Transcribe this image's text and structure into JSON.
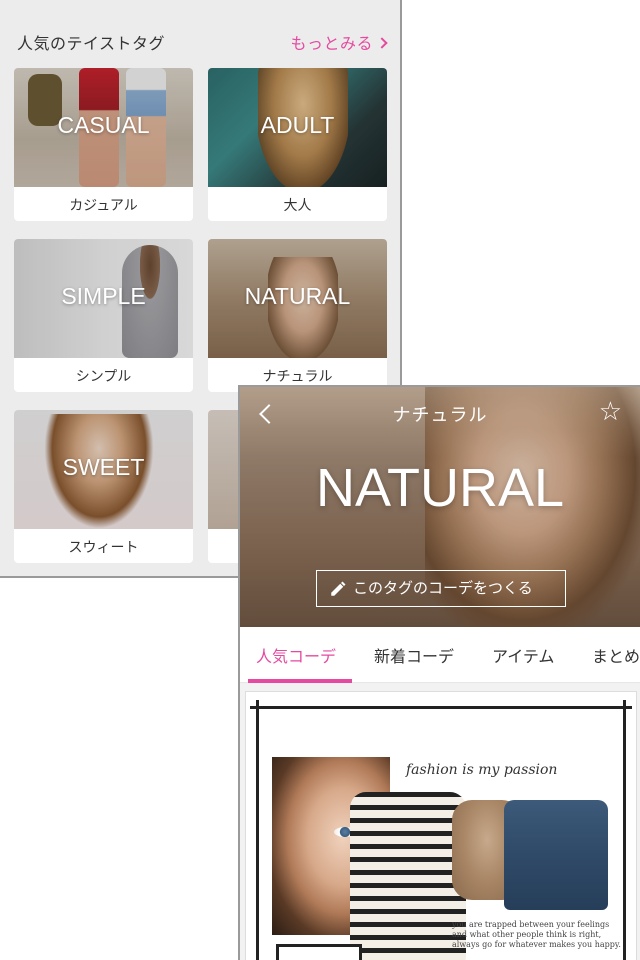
{
  "tags_screen": {
    "title": "人気のテイストタグ",
    "more_label": "もっとみる",
    "more_icon": "chevron-right-icon",
    "accent_color": "#e54aa0",
    "cards": [
      {
        "eng": "CASUAL",
        "jp": "カジュアル"
      },
      {
        "eng": "ADULT",
        "jp": "大人"
      },
      {
        "eng": "SIMPLE",
        "jp": "シンプル"
      },
      {
        "eng": "NATURAL",
        "jp": "ナチュラル"
      },
      {
        "eng": "SWEET",
        "jp": "スウィート"
      },
      {
        "eng": "",
        "jp": ""
      }
    ]
  },
  "detail_screen": {
    "header_title": "ナチュラル",
    "back_icon": "chevron-left-icon",
    "favorite_icon": "star-outline-icon",
    "hero_text": "NATURAL",
    "create_button_label": "このタグのコーデをつくる",
    "create_button_icon": "pencil-icon",
    "tabs": [
      {
        "label": "人気コーデ",
        "active": true
      },
      {
        "label": "新着コーデ",
        "active": false
      },
      {
        "label": "アイテム",
        "active": false
      },
      {
        "label": "まとめ",
        "active": false
      }
    ],
    "feed_item": {
      "caption": "fashion is my passion",
      "body_text": "you are trapped between your feelings and what other people think is right, always go for whatever makes you happy."
    }
  }
}
